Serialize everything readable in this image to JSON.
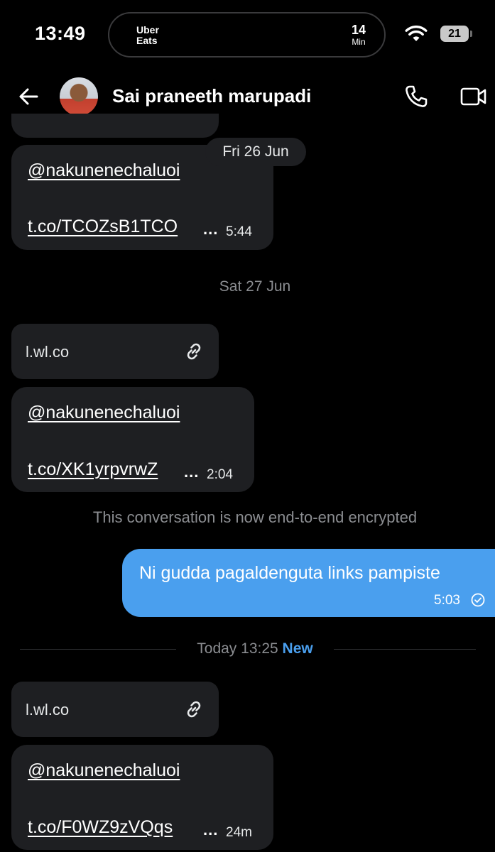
{
  "status_bar": {
    "time": "13:49",
    "live_activity": {
      "brand_line1": "Uber",
      "brand_line2": "Eats",
      "eta_value": "14",
      "eta_unit": "Min"
    },
    "battery": "21"
  },
  "header": {
    "contact_name": "Sai praneeth marupadi"
  },
  "messages": [
    {
      "mention": "@nakunenechaluoi",
      "link": "t.co/TCOZsB1TCO",
      "more": "...",
      "time": "5:44"
    },
    {
      "mention": "@nakunenechaluoi",
      "link": "t.co/XK1yrpvrwZ",
      "more": "...",
      "time": "2:04"
    },
    {
      "mention": "@nakunenechaluoi",
      "link": "t.co/F0WZ9zVQqs",
      "more": "...",
      "time": "24m"
    }
  ],
  "dates": {
    "fri": "Fri 26 Jun",
    "sat": "Sat 27 Jun",
    "today": "Today 13:25",
    "new_badge": "New"
  },
  "link_cards": [
    {
      "domain": "l.wl.co"
    },
    {
      "domain": "l.wl.co"
    }
  ],
  "system_note": "This conversation is now end-to-end encrypted",
  "outgoing": {
    "text": "Ni gudda pagaldenguta links pampiste",
    "time": "5:03"
  },
  "colors": {
    "background": "#000000",
    "bubble_incoming": "#1e1f22",
    "bubble_outgoing": "#4a9fee",
    "muted_text": "#8b8d91"
  }
}
